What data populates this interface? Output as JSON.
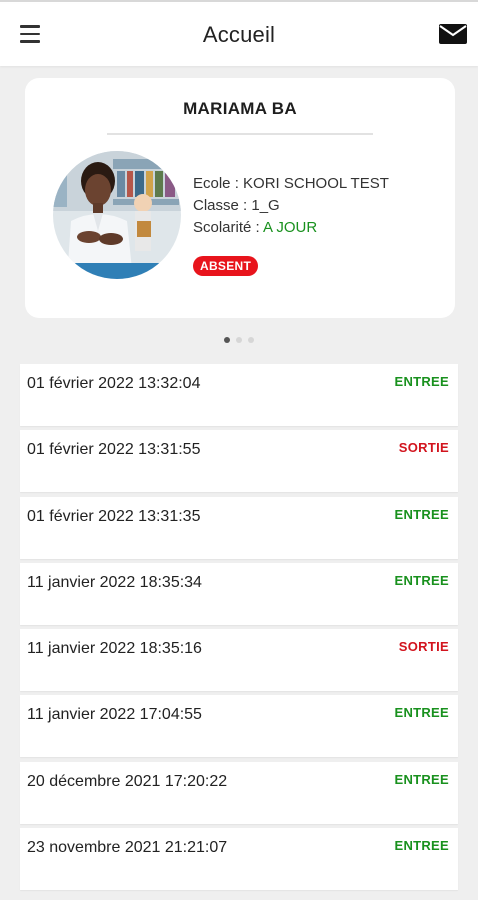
{
  "header": {
    "title": "Accueil"
  },
  "student": {
    "name": "MARIAMA BA",
    "ecole": "Ecole : KORI SCHOOL TEST",
    "classe": "Classe : 1_G",
    "scolarite_label": "Scolarité : ",
    "scolarite_value": "A JOUR",
    "presence_badge": "ABSENT"
  },
  "carousel": {
    "page_count": 3,
    "active_index": 0
  },
  "entries": [
    {
      "date": "01 février 2022 13:32:04",
      "status": "ENTREE"
    },
    {
      "date": "01 février 2022 13:31:55",
      "status": "SORTIE"
    },
    {
      "date": "01 février 2022 13:31:35",
      "status": "ENTREE"
    },
    {
      "date": "11 janvier 2022 18:35:34",
      "status": "ENTREE"
    },
    {
      "date": "11 janvier 2022 18:35:16",
      "status": "SORTIE"
    },
    {
      "date": "11 janvier 2022 17:04:55",
      "status": "ENTREE"
    },
    {
      "date": "20 décembre 2021 17:20:22",
      "status": "ENTREE"
    },
    {
      "date": "23 novembre 2021 21:21:07",
      "status": "ENTREE"
    }
  ],
  "colors": {
    "entree": "#19911e",
    "sortie": "#d2141e",
    "badge": "#e8141c"
  },
  "icons": {
    "menu": "hamburger-menu-icon",
    "mail": "envelope-icon"
  }
}
